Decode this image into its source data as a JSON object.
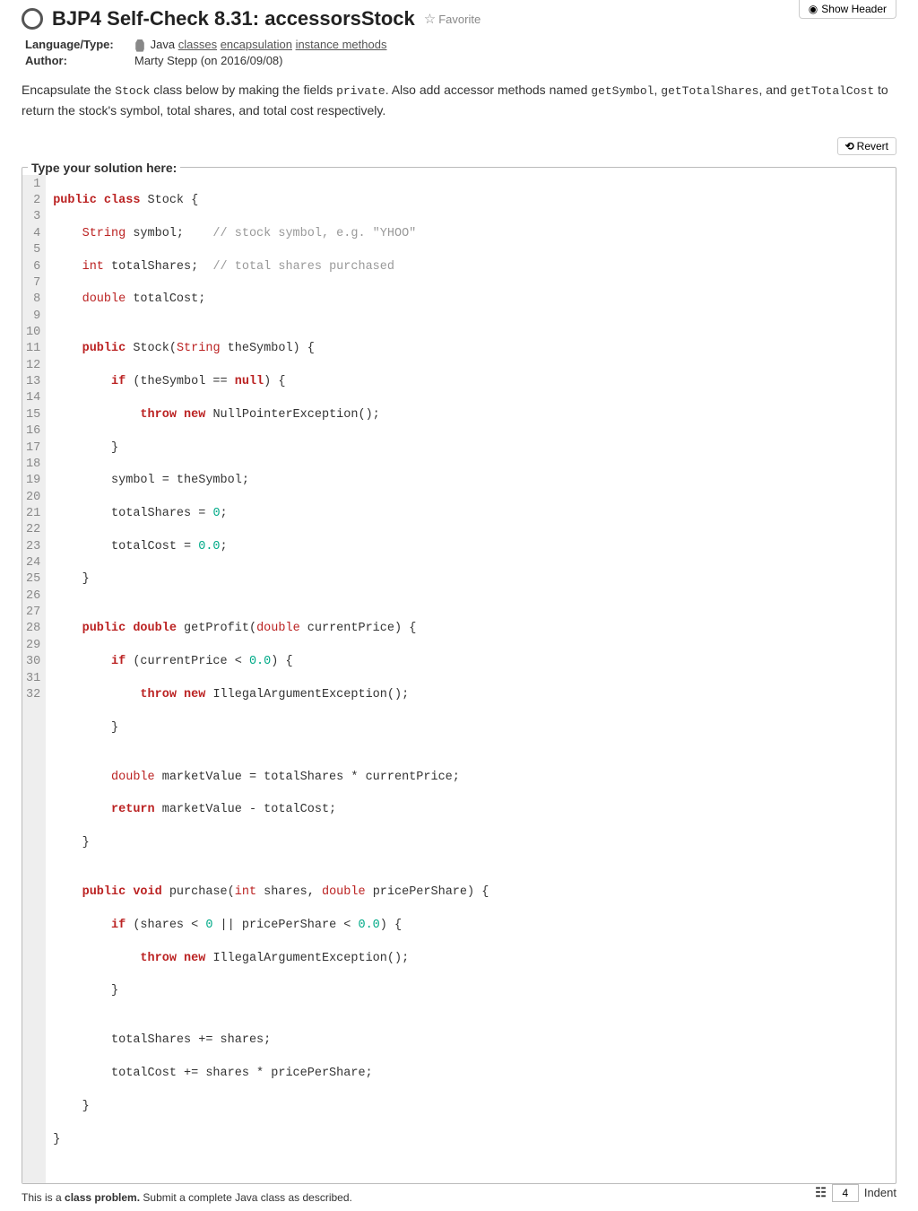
{
  "header": {
    "title": "BJP4 Self-Check 8.31: accessorsStock",
    "favorite_label": "Favorite",
    "show_header_label": "Show Header"
  },
  "meta": {
    "language_type_label": "Language/Type:",
    "language": "Java",
    "tag_classes": "classes",
    "tag_encapsulation": "encapsulation",
    "tag_instance_methods": "instance methods",
    "author_label": "Author:",
    "author_value": "Marty Stepp (on 2016/09/08)"
  },
  "description": {
    "part1": "Encapsulate the ",
    "code1": "Stock",
    "part2": " class below by making the fields ",
    "code2": "private",
    "part3": ". Also add accessor methods named ",
    "code3": "getSymbol",
    "part4": ", ",
    "code4": "getTotalShares",
    "part5": ", and ",
    "code5": "getTotalCost",
    "part6": " to return the stock's symbol, total shares, and total cost respectively."
  },
  "buttons": {
    "revert": "Revert"
  },
  "solution": {
    "legend": "Type your solution here:",
    "line_count": 32
  },
  "code": {
    "l1": {
      "a": "public class",
      "b": " Stock {"
    },
    "l2": {
      "a": "    String",
      "b": " symbol;",
      "c": "    // stock symbol, e.g. \"YHOO\""
    },
    "l3": {
      "a": "    int",
      "b": " totalShares;",
      "c": "  // total shares purchased"
    },
    "l4": {
      "a": "    double",
      "b": " totalCost;"
    },
    "l5": "",
    "l6": {
      "a": "    public",
      "b": " Stock(",
      "c": "String",
      "d": " theSymbol) {"
    },
    "l7": {
      "a": "        if",
      "b": " (theSymbol == ",
      "c": "null",
      "d": ") {"
    },
    "l8": {
      "a": "            throw new",
      "b": " NullPointerException();"
    },
    "l9": "        }",
    "l10": "        symbol = theSymbol;",
    "l11": {
      "a": "        totalShares = ",
      "n": "0",
      "b": ";"
    },
    "l12": {
      "a": "        totalCost = ",
      "n": "0.0",
      "b": ";"
    },
    "l13": "    }",
    "l14": "",
    "l15": {
      "a": "    public double",
      "b": " getProfit(",
      "c": "double",
      "d": " currentPrice) {"
    },
    "l16": {
      "a": "        if",
      "b": " (currentPrice < ",
      "n": "0.0",
      "c": ") {"
    },
    "l17": {
      "a": "            throw new",
      "b": " IllegalArgumentException();"
    },
    "l18": "        }",
    "l19": "",
    "l20": {
      "a": "        double",
      "b": " marketValue = totalShares * currentPrice;"
    },
    "l21": {
      "a": "        return",
      "b": " marketValue - totalCost;"
    },
    "l22": "    }",
    "l23": "",
    "l24": {
      "a": "    public void",
      "b": " purchase(",
      "c": "int",
      "d": " shares, ",
      "e": "double",
      "f": " pricePerShare) {"
    },
    "l25": {
      "a": "        if",
      "b": " (shares < ",
      "n1": "0",
      "c": " || pricePerShare < ",
      "n2": "0.0",
      "d": ") {"
    },
    "l26": {
      "a": "            throw new",
      "b": " IllegalArgumentException();"
    },
    "l27": "        }",
    "l28": "",
    "l29": "        totalShares += shares;",
    "l30": "        totalCost += shares * pricePerShare;",
    "l31": "    }",
    "l32": "}"
  },
  "footer": {
    "note_a": "This is a ",
    "note_b": "class problem.",
    "note_c": " Submit a complete Java class as described.",
    "indent_value": "4",
    "indent_label": "Indent"
  }
}
